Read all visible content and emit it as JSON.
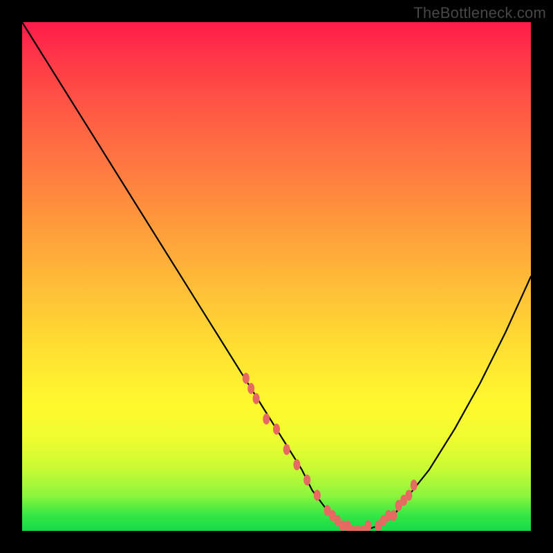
{
  "watermark": "TheBottleneck.com",
  "colors": {
    "frame": "#000000",
    "gradient_top": "#ff1b4a",
    "gradient_bottom": "#14db4a",
    "curve": "#000000",
    "dots": "#e66a62"
  },
  "chart_data": {
    "type": "line",
    "title": "",
    "xlabel": "",
    "ylabel": "",
    "xlim": [
      0,
      100
    ],
    "ylim": [
      0,
      100
    ],
    "grid": false,
    "legend": false,
    "annotations": [
      "TheBottleneck.com"
    ],
    "series": [
      {
        "name": "curve",
        "x": [
          0,
          5,
          10,
          15,
          20,
          25,
          30,
          35,
          40,
          45,
          50,
          55,
          57,
          60,
          63,
          65,
          67,
          70,
          73,
          76,
          80,
          85,
          90,
          95,
          100
        ],
        "y": [
          100,
          92,
          84,
          76,
          68,
          60,
          52,
          44,
          36,
          28,
          20,
          12,
          8,
          4,
          1,
          0,
          0,
          1,
          3,
          7,
          12,
          20,
          29,
          39,
          50
        ]
      }
    ],
    "highlighted_points": {
      "name": "dots",
      "comment": "Salmon scatter markers clustered along the curve near the trough and adjacent slopes",
      "x": [
        44,
        45,
        46,
        48,
        50,
        52,
        54,
        56,
        58,
        60,
        61,
        62,
        63,
        64,
        65,
        66,
        67,
        68,
        70,
        71,
        72,
        73,
        74,
        75,
        76,
        77
      ],
      "y": [
        30,
        28,
        26,
        22,
        20,
        16,
        13,
        10,
        7,
        4,
        3,
        2,
        1,
        1,
        0,
        0,
        0,
        1,
        1,
        2,
        3,
        3,
        5,
        6,
        7,
        9
      ]
    }
  }
}
